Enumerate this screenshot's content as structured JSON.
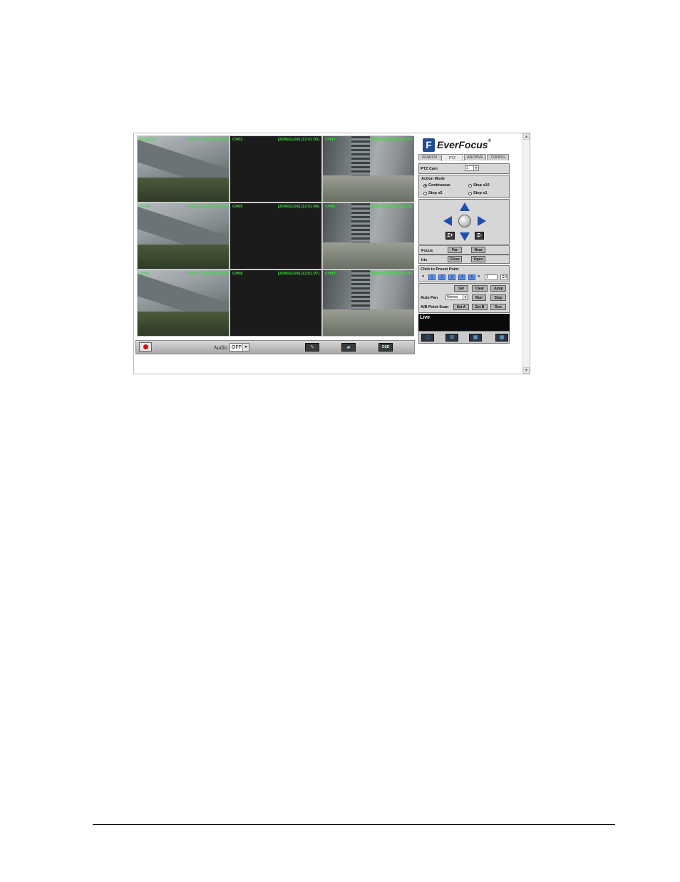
{
  "brand": {
    "name": "EverFocus",
    "mark": "F",
    "reg": "®"
  },
  "tabs": [
    {
      "label": "SEARCH",
      "active": false
    },
    {
      "label": "PTZ",
      "active": true
    },
    {
      "label": "ARCHIVE",
      "active": false
    },
    {
      "label": "CONFIG",
      "active": false
    }
  ],
  "channels": [
    {
      "label": "11111111",
      "timestamp": "[2006/11/24] [13:51:05]",
      "scene": "road"
    },
    {
      "label": "CH02",
      "timestamp": "[2006/11/24] [13:51:05]",
      "scene": "dark"
    },
    {
      "label": "CH03",
      "timestamp": "[2006/11/24] [13:51:05]",
      "scene": "bld"
    },
    {
      "label": "CH04",
      "timestamp": "[2006/11/24] [13:51:06]",
      "scene": "road"
    },
    {
      "label": "CH05",
      "timestamp": "[2006/11/24] [13:51:06]",
      "scene": "dark"
    },
    {
      "label": "CH06",
      "timestamp": "[2006/11/24] [13:51:06]",
      "scene": "bld"
    },
    {
      "label": "CH07",
      "timestamp": "[2006/11/24] [13:51:07]",
      "scene": "road"
    },
    {
      "label": "CH08",
      "timestamp": "[2006/11/24] [13:51:07]",
      "scene": "dark"
    },
    {
      "label": "CH09",
      "timestamp": "[2006/11/24] [13:51:07]",
      "scene": "bld"
    }
  ],
  "toolbar": {
    "audio_label": "Audio",
    "audio_value": "OFF",
    "osd_label": "OSD"
  },
  "ptz": {
    "cam_label": "PTZ Cam",
    "cam_value": "1",
    "action_mode_label": "Action Mode",
    "modes": [
      {
        "label": "Continuous",
        "selected": true
      },
      {
        "label": "Step x10",
        "selected": false
      },
      {
        "label": "Step x5",
        "selected": false
      },
      {
        "label": "Step x1",
        "selected": false
      }
    ],
    "zoom_in": "Z+",
    "zoom_out": "Z-",
    "focus_label": "Focus",
    "focus_far": "Far",
    "focus_near": "Near",
    "iris_label": "Iris",
    "iris_close": "Close",
    "iris_open": "Open",
    "preset_label": "Click to Preset Point",
    "preset_prev": "«",
    "preset_next": "»",
    "presets": [
      "1",
      "2",
      "3",
      "4",
      "5"
    ],
    "preset_input": "1",
    "preset_go": "GO",
    "set": "Set",
    "clear": "Clear",
    "jump": "Jump",
    "auto_pan_label": "Auto Pan",
    "auto_pan_value": "Norma",
    "run": "Run",
    "stop": "Stop",
    "ab_scan_label": "A/B Point Scan",
    "set_a": "Set A",
    "set_b": "Set B",
    "ab_run": "Run"
  },
  "live_label": "Live"
}
